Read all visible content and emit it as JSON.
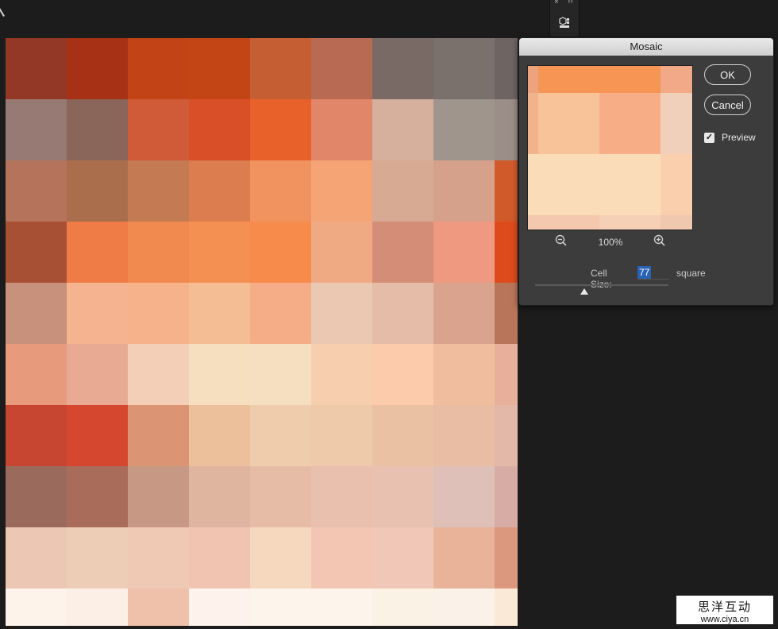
{
  "dialog": {
    "title": "Mosaic",
    "ok_label": "OK",
    "cancel_label": "Cancel",
    "preview_label": "Preview",
    "preview_checked": true,
    "zoom_level": "100%",
    "cell_size_label": "Cell Size:",
    "cell_size_value": "77",
    "cell_size_unit": "square",
    "slider_value": 77
  },
  "mosaic_rows": [
    [
      "#933726",
      "#a73115",
      "#c24416",
      "#c34415",
      "#c65e33",
      "#b96a52",
      "#7a6a66",
      "#7a706c",
      "#6e6462"
    ],
    [
      "#977a74",
      "#8a665a",
      "#d05b38",
      "#d95028",
      "#e8602a",
      "#e2866a",
      "#d6b09c",
      "#a0958d",
      "#9b8d87"
    ],
    [
      "#b6735b",
      "#ab6e4d",
      "#c47a53",
      "#db7d4f",
      "#f0935f",
      "#f5a575",
      "#d7ab93",
      "#d6a18b",
      "#d15a2b"
    ],
    [
      "#a75034",
      "#ef7b47",
      "#f08a4e",
      "#f49152",
      "#f68b4c",
      "#f0aa83",
      "#d48e77",
      "#ef9a80",
      "#dd4b1c"
    ],
    [
      "#c7917b",
      "#f5b38f",
      "#f6b28b",
      "#f4bd94",
      "#f4ad87",
      "#eac8b1",
      "#e4bca8",
      "#d9a38d",
      "#b97559"
    ],
    [
      "#e89a7c",
      "#e8aa92",
      "#f2cfb6",
      "#f5dfbf",
      "#f5dfc0",
      "#f7cfae",
      "#fbcbab",
      "#f0bd9f",
      "#e8b09a"
    ],
    [
      "#c64632",
      "#d5472e",
      "#db9575",
      "#edc09c",
      "#efccab",
      "#efcaaa",
      "#ebc1a4",
      "#e8bda3",
      "#e3b8a8"
    ],
    [
      "#9a6b5d",
      "#a96c5a",
      "#c79984",
      "#e0b5a0",
      "#e6bca6",
      "#e9c0ad",
      "#e8c1b1",
      "#dfc0b9",
      "#d6aca4"
    ],
    [
      "#ecc8b4",
      "#eecdb6",
      "#f0c9b5",
      "#f0c4b1",
      "#f5d8be",
      "#f2c6b2",
      "#f1c8b7",
      "#e8b399",
      "#db987f"
    ],
    [
      "#fef3ea",
      "#fcefe6",
      "#f0c1aa",
      "#fdf3ec",
      "#fdf5ec",
      "#fdf5ec",
      "#f9f2e5",
      "#faf2e8",
      "#fbe9d7"
    ]
  ],
  "preview_rows": [
    [
      "#eda47e",
      "#f79554",
      "#f79554",
      "#f2a987"
    ],
    [
      "#f0b38c",
      "#f9c39a",
      "#f7ad86",
      "#f0d0bb"
    ],
    [
      "#fbdcb8",
      "#fbdcb8",
      "#fbdcb8",
      "#f9cfae"
    ],
    [
      "#f4c8ae",
      "#f4c8ae",
      "#f5cfb6",
      "#f0c8b0"
    ]
  ],
  "watermark": {
    "line1": "思洋互动",
    "line2": "www.ciya.cn"
  }
}
